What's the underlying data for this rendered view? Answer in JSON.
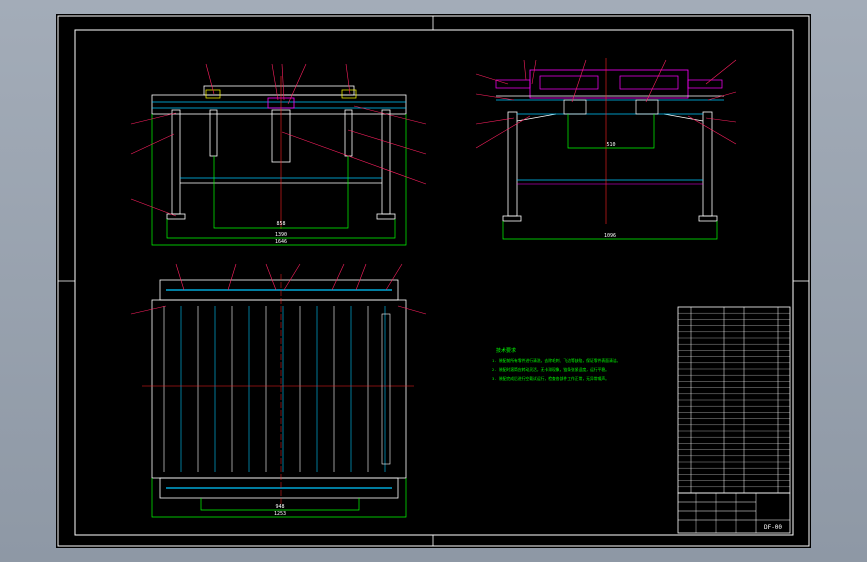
{
  "drawing": {
    "front_view": {
      "dims": {
        "inner": "858",
        "mid": "1390",
        "overall": "1646"
      }
    },
    "side_view": {
      "dims": {
        "top": "510",
        "bottom": "1096"
      }
    },
    "plan_view": {
      "dims": {
        "inner": "948",
        "overall": "1253"
      }
    },
    "notes": {
      "heading": "技术要求",
      "lines": [
        "1. 装配前所有零件进行清洗，去除毛刺、飞边等缺陷，保证零件表面清洁。",
        "2. 装配时滚筒应转动灵活，无卡滞现象，链条张紧适度，运行平稳。",
        "3. 装配完成后进行空载试运行，检查各部件工作正常，无异常噪声。"
      ]
    },
    "title_block": {
      "drawing_number": "DF-00"
    },
    "colors": {
      "frame": "#ffffff",
      "structure": "#00c8ff",
      "dimension": "#00ff00",
      "leader": "#ff2060",
      "centerline": "#ff2020",
      "accent": "#ff00ff"
    }
  }
}
